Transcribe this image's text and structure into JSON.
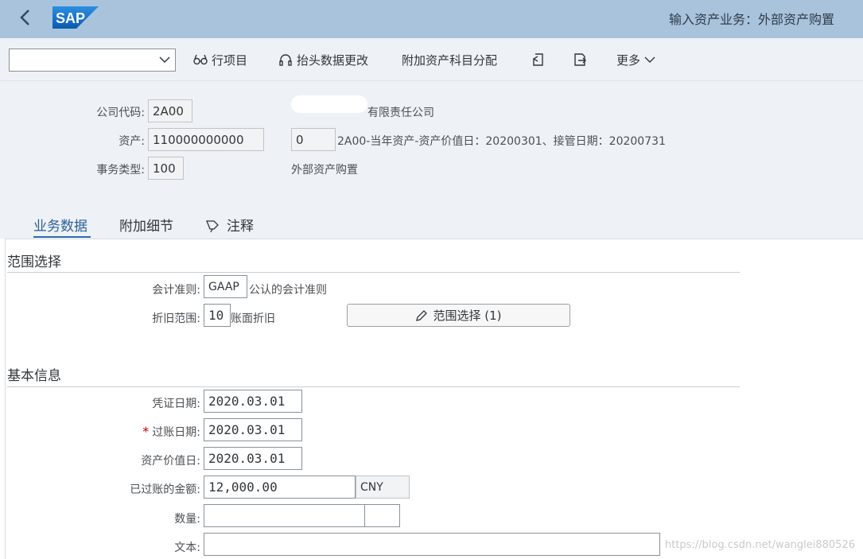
{
  "shell": {
    "title": "输入资产业务：外部资产购置",
    "logo_text": "SAP",
    "brand_color": "#1a73c7"
  },
  "toolbar": {
    "variant_value": "",
    "line_items_label": "行项目",
    "header_change_label": "抬头数据更改",
    "account_assignment_label": "附加资产科目分配",
    "more_label": "更多"
  },
  "header": {
    "company_code_label": "公司代码:",
    "company_code_value": "2A00",
    "company_name": "有限责任公司",
    "asset_label": "资产:",
    "asset_value": "110000000000",
    "subnumber_value": "0",
    "asset_desc": "2A00-当年资产-资产价值日：20200301、接管日期：20200731",
    "trans_type_label": "事务类型:",
    "trans_type_value": "100",
    "trans_type_desc": "外部资产购置"
  },
  "tabs": [
    {
      "label": "业务数据"
    },
    {
      "label": "附加细节"
    },
    {
      "label": "注释"
    }
  ],
  "scope": {
    "section_title": "范围选择",
    "ledger_label": "会计准则:",
    "ledger_value": "GAAP",
    "ledger_desc": "公认的会计准则",
    "area_label": "折旧范围:",
    "area_value": "10",
    "area_desc": "账面折旧",
    "range_button_label": "范围选择 (1)"
  },
  "basic": {
    "section_title": "基本信息",
    "doc_date_label": "凭证日期:",
    "doc_date_value": "2020.03.01",
    "posting_date_label": "过账日期:",
    "posting_date_value": "2020.03.01",
    "value_date_label": "资产价值日:",
    "value_date_value": "2020.03.01",
    "amount_label": "已过账的金额:",
    "amount_value": "12,000.00",
    "currency_value": "CNY",
    "quantity_label": "数量:",
    "quantity_value": "",
    "unit_value": "",
    "text_label": "文本:",
    "text_value": ""
  },
  "watermark": "https://blog.csdn.net/wanglei880526"
}
